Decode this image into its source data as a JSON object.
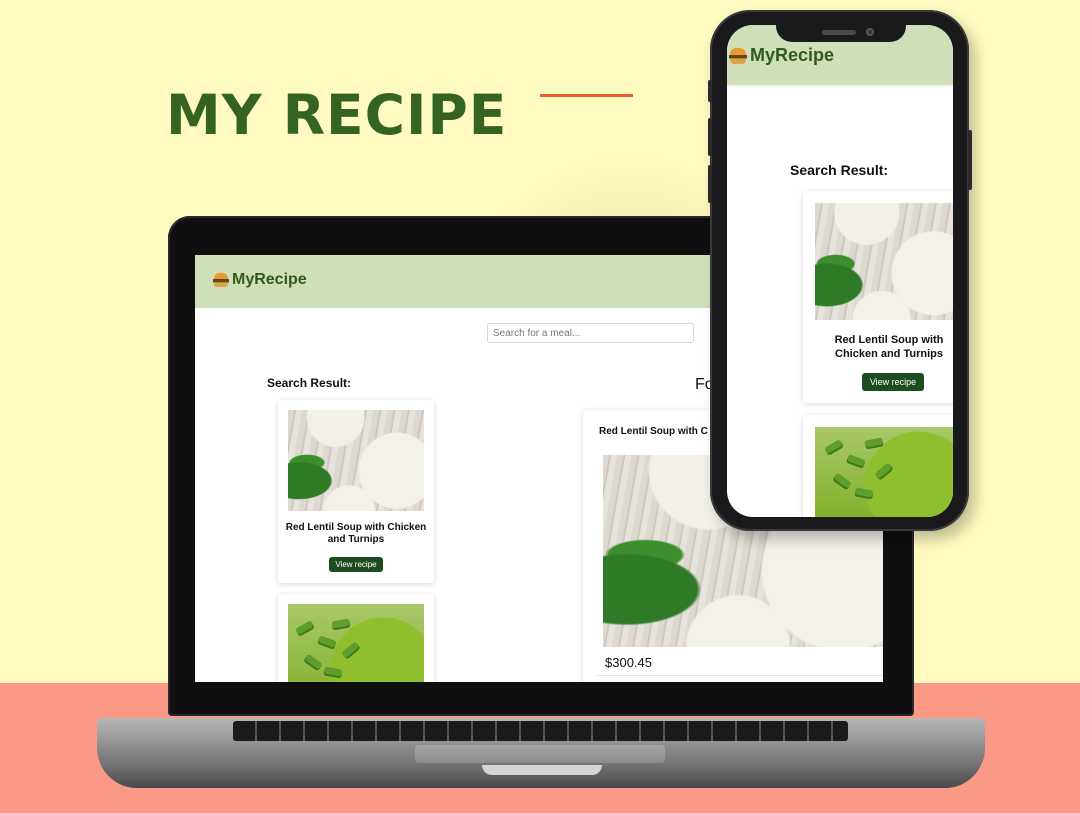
{
  "hero": {
    "title": "MY RECIPE"
  },
  "brand": {
    "name": "MyRecipe",
    "icon": "burger-icon"
  },
  "search": {
    "placeholder": "Search for a meal..."
  },
  "results": {
    "heading": "Search Result:",
    "items": [
      {
        "title": "Red Lentil Soup with Chicken and Turnips",
        "button": "View recipe"
      },
      {
        "title": "",
        "button": ""
      }
    ]
  },
  "detail": {
    "heading_partial": "Fo",
    "title": "Red Lentil Soup with C",
    "price": "$300.45"
  },
  "colors": {
    "background": "#fefac0",
    "floor": "#fb9987",
    "hero_title": "#356323",
    "accent": "#ea5b36",
    "header": "#cfe0b8",
    "brand_text": "#2f5a1d",
    "button": "#1d4d1f"
  }
}
